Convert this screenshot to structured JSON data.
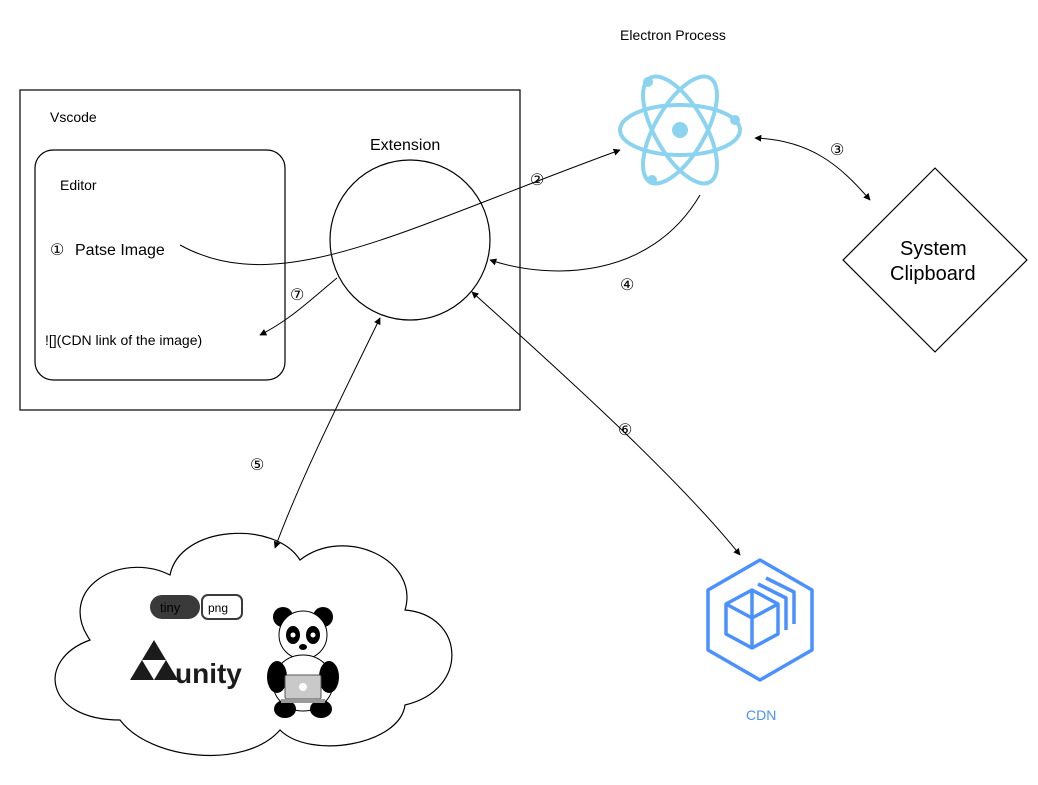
{
  "title_electron": "Electron Process",
  "vscode_label": "Vscode",
  "editor_label": "Editor",
  "extension_label": "Extension",
  "paste_image": "Patse Image",
  "cdn_output": "![](CDN link of the image)",
  "system_clipboard_line1": "System",
  "system_clipboard_line2": "Clipboard",
  "cdn_label": "CDN",
  "tiny_label": "tiny",
  "png_label": "png",
  "unity_label": "unity",
  "step1": "①",
  "step2": "②",
  "step3": "③",
  "step4": "④",
  "step5": "⑤",
  "step6": "⑥",
  "step7": "⑦"
}
